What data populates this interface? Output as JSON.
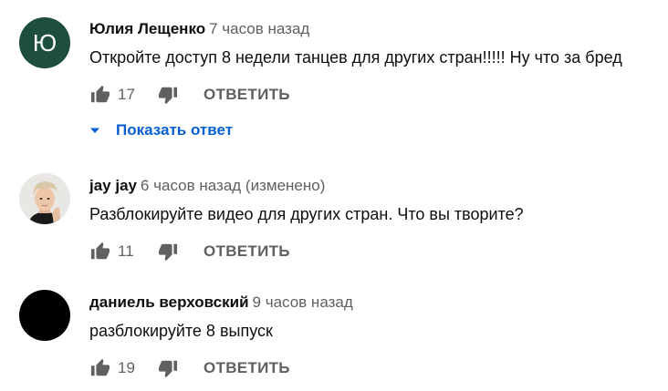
{
  "comments": [
    {
      "author": "Юлия Лещенко",
      "time": "7 часов назад",
      "text": "Откройте доступ 8 недели танцев для других стран!!!!! Ну что за бред",
      "likes": "17",
      "reply_label": "ОТВЕТИТЬ",
      "avatar_letter": "Ю",
      "avatar_color": "#1e4f3c"
    },
    {
      "author": "jay jay",
      "time": "6 часов назад (изменено)",
      "text": "Разблокируйте видео для других стран. Что вы творите?",
      "likes": "11",
      "reply_label": "ОТВЕТИТЬ"
    },
    {
      "author": "даниель верховский",
      "time": "9 часов назад",
      "text": "разблокируйте 8 выпуск",
      "likes": "19",
      "reply_label": "ОТВЕТИТЬ"
    }
  ],
  "show_reply": {
    "label": "Показать ответ",
    "icon": "chevron-down-icon"
  },
  "colors": {
    "link": "#065fd4",
    "secondary_text": "#606060",
    "icon": "#606060"
  }
}
